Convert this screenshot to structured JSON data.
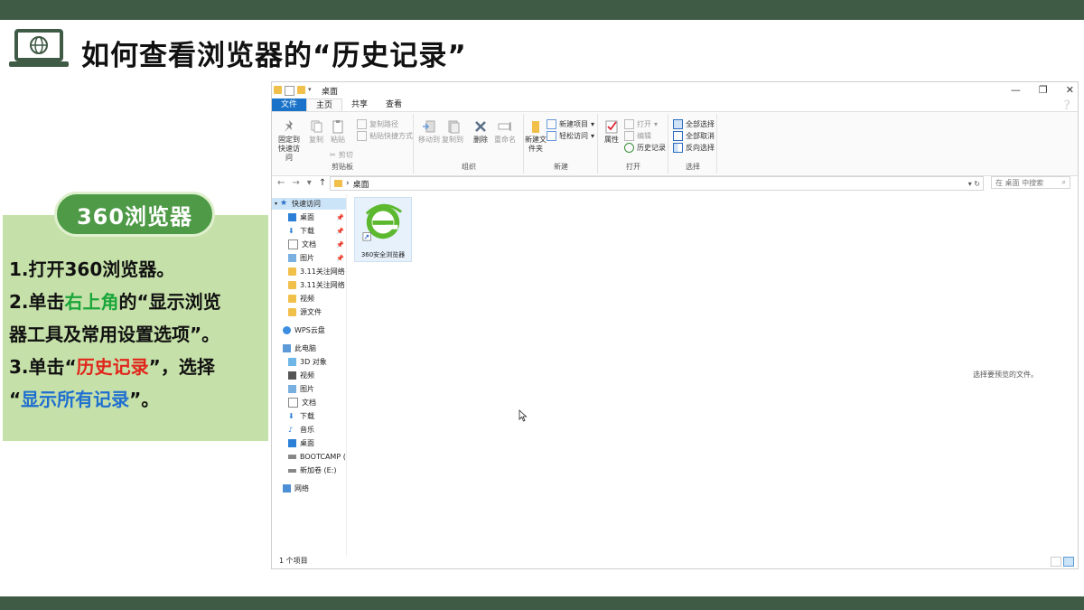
{
  "slide": {
    "title": "如何查看浏览器的“历史记录”",
    "badge": "360浏览器",
    "steps": {
      "s1": "1.打开360浏览器。",
      "s2_prefix": "2.单击",
      "s2_highlight": "右上角",
      "s2_mid": "的“显示浏览",
      "s2_line2": "器工具及常用设置选项”。",
      "s3_prefix": "3.单击“",
      "s3_highlight": "历史记录",
      "s3_suffix": "”，选择",
      "s3_line2_open": "“",
      "s3_line2_highlight": "显示所有记录",
      "s3_line2_close": "”。"
    },
    "colors": {
      "band": "#3f5a45",
      "panel": "#c5e0a8",
      "badge": "#4e9a47",
      "green_text": "#1aa63a",
      "red_text": "#e1261c",
      "blue_text": "#1f6fd1"
    }
  },
  "explorer": {
    "window_title": "桌面",
    "tabs": [
      "文件",
      "主页",
      "共享",
      "查看"
    ],
    "ribbon": {
      "clipboard": {
        "pin": "固定到快速访问",
        "copy": "复制",
        "paste": "粘贴",
        "copy_path": "复制路径",
        "paste_shortcut": "粘贴快捷方式",
        "cut": "剪切",
        "label": "剪贴板"
      },
      "organize": {
        "move_to": "移动到",
        "copy_to": "复制到",
        "delete": "删除",
        "rename": "重命名",
        "label": "组织"
      },
      "new": {
        "new_folder": "新建文件夹",
        "new_item": "新建项目",
        "easy_access": "轻松访问",
        "label": "新建"
      },
      "open": {
        "properties": "属性",
        "open": "打开",
        "edit": "编辑",
        "history": "历史记录",
        "label": "打开"
      },
      "select": {
        "select_all": "全部选择",
        "select_none": "全部取消",
        "invert": "反向选择",
        "label": "选择"
      }
    },
    "address": {
      "crumb": "桌面",
      "search_placeholder": "在 桌面 中搜索"
    },
    "tree": {
      "quick_access": "快速访问",
      "desktop": "桌面",
      "downloads": "下载",
      "documents": "文档",
      "pictures": "图片",
      "folder1": "3.11关注网络",
      "folder2": "3.11关注网络",
      "videos": "视频",
      "source": "源文件",
      "wps": "WPS云盘",
      "this_pc": "此电脑",
      "objects3d": "3D 对象",
      "pc_videos": "视频",
      "pc_pictures": "图片",
      "pc_documents": "文档",
      "pc_downloads": "下载",
      "music": "音乐",
      "pc_desktop": "桌面",
      "bootcamp": "BOOTCAMP (",
      "new_volume": "新加卷 (E:)",
      "network": "网络"
    },
    "file": {
      "name": "360安全浏览器"
    },
    "preview_text": "选择要预览的文件。",
    "status": "1 个项目"
  }
}
